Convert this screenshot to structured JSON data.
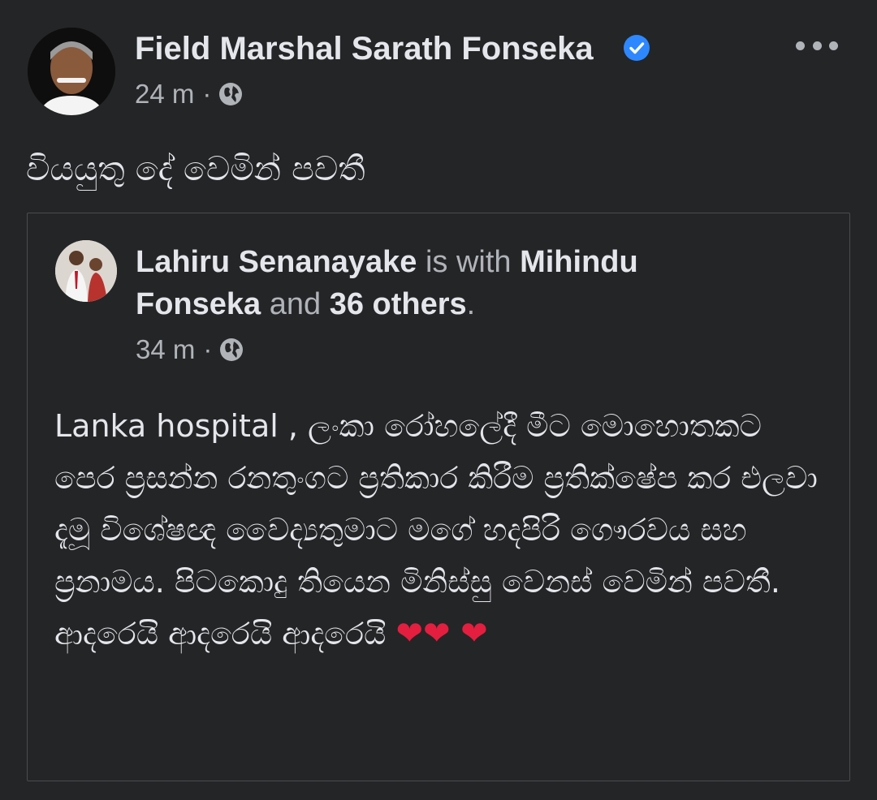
{
  "post": {
    "author": "Field Marshal Sarath Fonseka",
    "verified": true,
    "time": "24 m",
    "separator": "·",
    "privacy_icon": "globe-icon",
    "text": "වියයුතු දේ වෙමින් පවතී"
  },
  "shared_post": {
    "author": "Lahiru Senanayake",
    "with_text": "is with",
    "tagged": "Mihindu Fonseka",
    "and_text": "and",
    "others": "36 others",
    "period": ".",
    "time": "34 m",
    "separator": "·",
    "privacy_icon": "globe-icon",
    "body": "Lanka hospital , ලංකා රෝහලේදී මීට මොහොතකට පෙර  ප්‍රසන්න රනතුංගට ප්‍රතිකාර කිරීම ප්‍රතික්ෂේප කර එලවා දැමූ විශේෂඥ වෛද්‍යතුමාට මගේ හදපිරි ගෞරවය සහ ප්‍රනාමය. පිටකොදු තියෙන මිනිස්සු වෙනස් වෙමින් පවතී. ආදරෙයි ආදරෙයි ආදරෙයි",
    "emojis": "❤❤ ❤"
  },
  "colors": {
    "background": "#242526",
    "primary_text": "#e4e6eb",
    "secondary_text": "#b0b3b8",
    "verified_blue": "#2d88ff",
    "heart_red": "#e41e3f"
  }
}
